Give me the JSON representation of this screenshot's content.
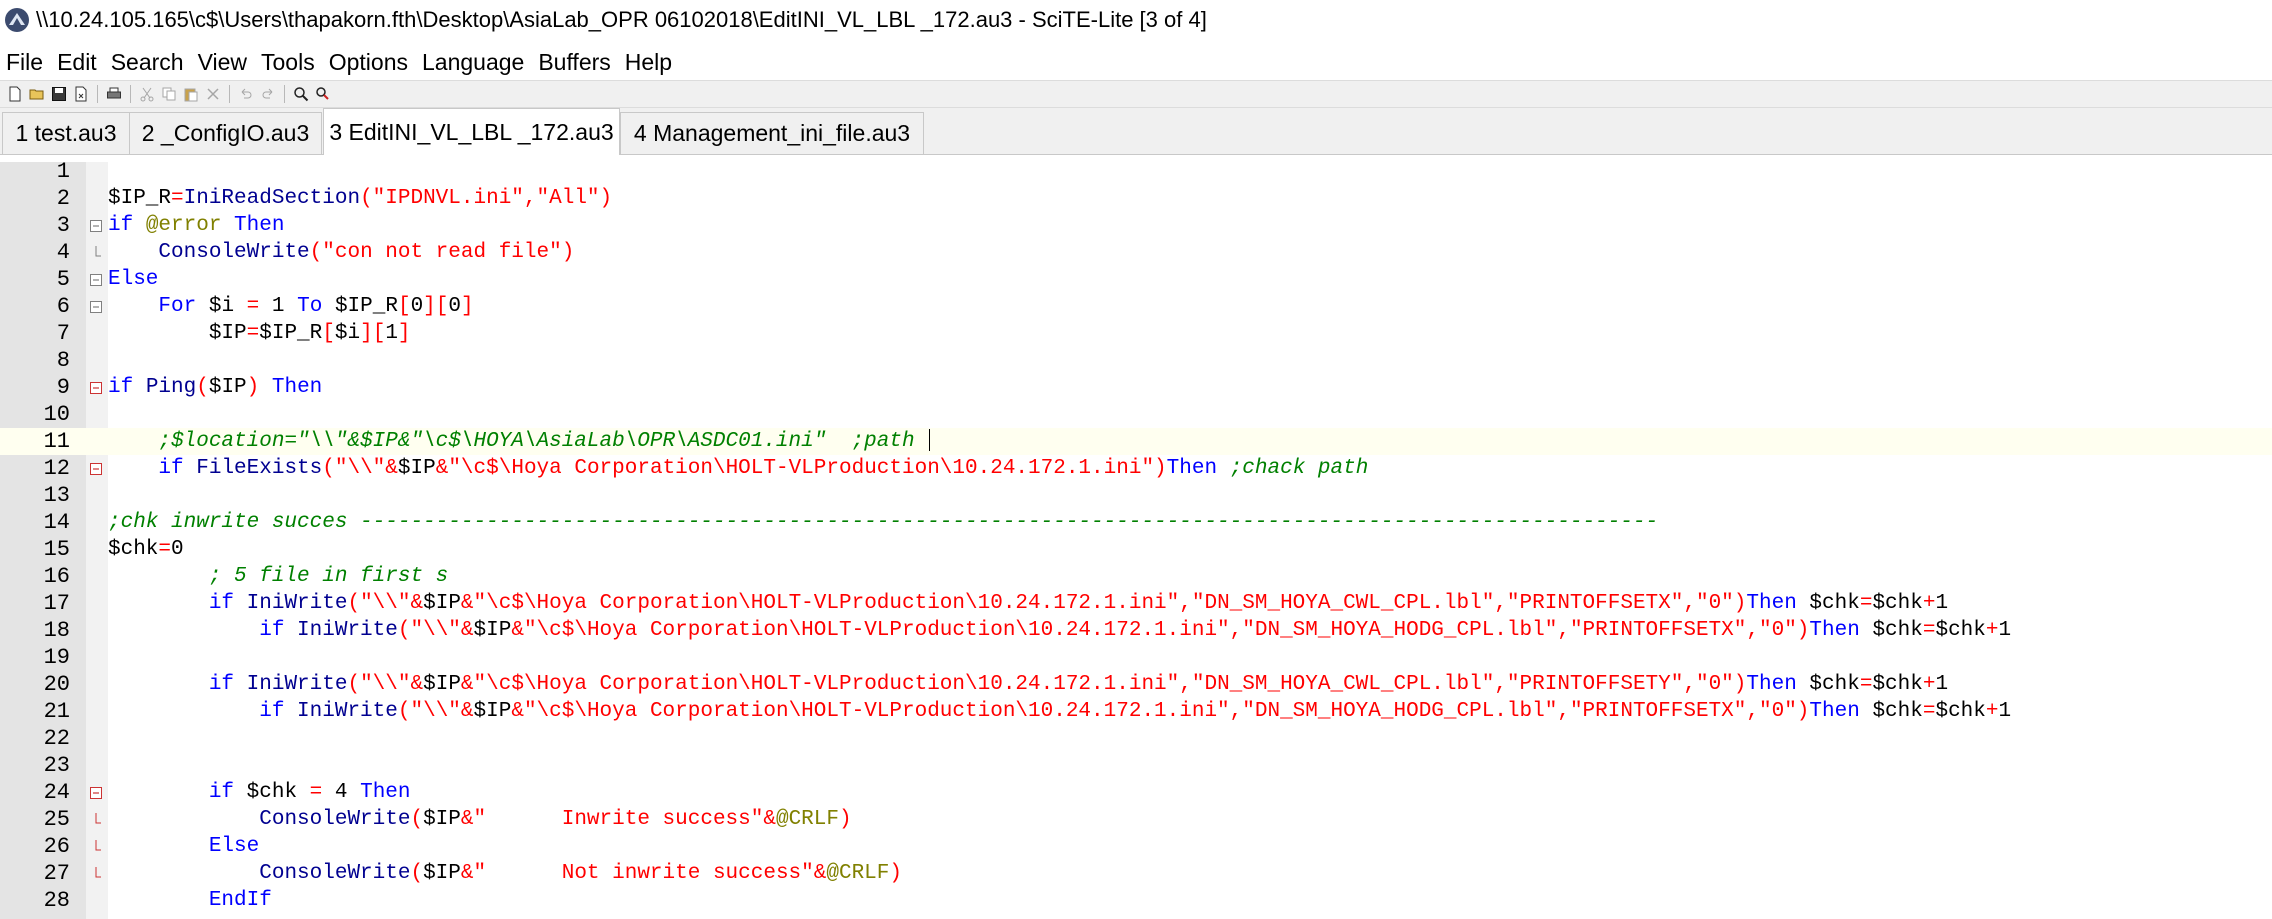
{
  "window": {
    "title": "\\\\10.24.105.165\\c$\\Users\\thapakorn.fth\\Desktop\\AsiaLab_OPR 06102018\\EditINI_VL_LBL _172.au3 - SciTE-Lite [3 of 4]",
    "app_icon": "scite-app-icon"
  },
  "menu": [
    "File",
    "Edit",
    "Search",
    "View",
    "Tools",
    "Options",
    "Language",
    "Buffers",
    "Help"
  ],
  "toolbar": [
    "new-file-icon",
    "open-folder-icon",
    "save-icon",
    "close-file-icon",
    "print-icon",
    "cut-icon",
    "copy-icon",
    "paste-icon",
    "delete-icon",
    "undo-icon",
    "redo-icon",
    "find-icon",
    "replace-icon"
  ],
  "tabs": [
    {
      "label": "1 test.au3",
      "active": false
    },
    {
      "label": "2 _ConfigIO.au3",
      "active": false
    },
    {
      "label": "3 EditINI_VL_LBL _172.au3",
      "active": true
    },
    {
      "label": "4 Management_ini_file.au3",
      "active": false
    }
  ],
  "colors": {
    "keyword": "#0000ff",
    "function": "#000090",
    "string": "#ff0000",
    "macro": "#808000",
    "comment": "#008000",
    "operator": "#ff0000",
    "number": "#000000",
    "variable": "#000000"
  },
  "editor": {
    "caret_line": 11,
    "lines": [
      [],
      [
        [
          "v",
          "$IP_R"
        ],
        [
          "o",
          "="
        ],
        [
          "f",
          "IniReadSection"
        ],
        [
          "o",
          "("
        ],
        [
          "s",
          "\"IPDNVL.ini\""
        ],
        [
          "o",
          ","
        ],
        [
          "s",
          "\"All\""
        ],
        [
          "o",
          ")"
        ]
      ],
      [
        [
          "k",
          "if "
        ],
        [
          "m",
          "@error"
        ],
        [
          "k",
          " Then"
        ]
      ],
      [
        [
          "t",
          "    "
        ],
        [
          "f",
          "ConsoleWrite"
        ],
        [
          "o",
          "("
        ],
        [
          "s",
          "\"con not read file\""
        ],
        [
          "o",
          ")"
        ]
      ],
      [
        [
          "k",
          "Else"
        ]
      ],
      [
        [
          "t",
          "    "
        ],
        [
          "k",
          "For"
        ],
        [
          "t",
          " "
        ],
        [
          "v",
          "$i"
        ],
        [
          "t",
          " "
        ],
        [
          "o",
          "="
        ],
        [
          "t",
          " "
        ],
        [
          "n",
          "1"
        ],
        [
          "t",
          " "
        ],
        [
          "k",
          "To"
        ],
        [
          "t",
          " "
        ],
        [
          "v",
          "$IP_R"
        ],
        [
          "o",
          "["
        ],
        [
          "n",
          "0"
        ],
        [
          "o",
          "]["
        ],
        [
          "n",
          "0"
        ],
        [
          "o",
          "]"
        ]
      ],
      [
        [
          "t",
          "        "
        ],
        [
          "v",
          "$IP"
        ],
        [
          "o",
          "="
        ],
        [
          "v",
          "$IP_R"
        ],
        [
          "o",
          "["
        ],
        [
          "v",
          "$i"
        ],
        [
          "o",
          "]["
        ],
        [
          "n",
          "1"
        ],
        [
          "o",
          "]"
        ]
      ],
      [],
      [
        [
          "k",
          "if "
        ],
        [
          "f",
          "Ping"
        ],
        [
          "o",
          "("
        ],
        [
          "v",
          "$IP"
        ],
        [
          "o",
          ")"
        ],
        [
          "k",
          " Then"
        ]
      ],
      [],
      [
        [
          "t",
          "    "
        ],
        [
          "c",
          ";$location=\"\\\\\"&$IP&\"\\c$\\HOYA\\AsiaLab\\OPR\\ASDC01.ini\"  ;path "
        ]
      ],
      [
        [
          "t",
          "    "
        ],
        [
          "k",
          "if "
        ],
        [
          "f",
          "FileExists"
        ],
        [
          "o",
          "("
        ],
        [
          "s",
          "\"\\\\\""
        ],
        [
          "o",
          "&"
        ],
        [
          "v",
          "$IP"
        ],
        [
          "o",
          "&"
        ],
        [
          "s",
          "\"\\c$\\Hoya Corporation\\HOLT-VLProduction\\10.24.172.1.ini\""
        ],
        [
          "o",
          ")"
        ],
        [
          "k",
          "Then"
        ],
        [
          "t",
          " "
        ],
        [
          "c",
          ";chack path"
        ]
      ],
      [],
      [
        [
          "c",
          ";chk inwrite succes -------------------------------------------------------------------------------------------------------"
        ]
      ],
      [
        [
          "v",
          "$chk"
        ],
        [
          "o",
          "="
        ],
        [
          "n",
          "0"
        ]
      ],
      [
        [
          "t",
          "        "
        ],
        [
          "c",
          "; 5 file in first s"
        ]
      ],
      [
        [
          "t",
          "        "
        ],
        [
          "k",
          "if "
        ],
        [
          "f",
          "IniWrite"
        ],
        [
          "o",
          "("
        ],
        [
          "s",
          "\"\\\\\""
        ],
        [
          "o",
          "&"
        ],
        [
          "v",
          "$IP"
        ],
        [
          "o",
          "&"
        ],
        [
          "s",
          "\"\\c$\\Hoya Corporation\\HOLT-VLProduction\\10.24.172.1.ini\""
        ],
        [
          "o",
          ","
        ],
        [
          "s",
          "\"DN_SM_HOYA_CWL_CPL.lbl\""
        ],
        [
          "o",
          ","
        ],
        [
          "s",
          "\"PRINTOFFSETX\""
        ],
        [
          "o",
          ","
        ],
        [
          "s",
          "\"0\""
        ],
        [
          "o",
          ")"
        ],
        [
          "k",
          "Then"
        ],
        [
          "t",
          " "
        ],
        [
          "v",
          "$chk"
        ],
        [
          "o",
          "="
        ],
        [
          "v",
          "$chk"
        ],
        [
          "o",
          "+"
        ],
        [
          "n",
          "1"
        ]
      ],
      [
        [
          "t",
          "            "
        ],
        [
          "k",
          "if "
        ],
        [
          "f",
          "IniWrite"
        ],
        [
          "o",
          "("
        ],
        [
          "s",
          "\"\\\\\""
        ],
        [
          "o",
          "&"
        ],
        [
          "v",
          "$IP"
        ],
        [
          "o",
          "&"
        ],
        [
          "s",
          "\"\\c$\\Hoya Corporation\\HOLT-VLProduction\\10.24.172.1.ini\""
        ],
        [
          "o",
          ","
        ],
        [
          "s",
          "\"DN_SM_HOYA_HODG_CPL.lbl\""
        ],
        [
          "o",
          ","
        ],
        [
          "s",
          "\"PRINTOFFSETX\""
        ],
        [
          "o",
          ","
        ],
        [
          "s",
          "\"0\""
        ],
        [
          "o",
          ")"
        ],
        [
          "k",
          "Then"
        ],
        [
          "t",
          " "
        ],
        [
          "v",
          "$chk"
        ],
        [
          "o",
          "="
        ],
        [
          "v",
          "$chk"
        ],
        [
          "o",
          "+"
        ],
        [
          "n",
          "1"
        ]
      ],
      [],
      [
        [
          "t",
          "        "
        ],
        [
          "k",
          "if "
        ],
        [
          "f",
          "IniWrite"
        ],
        [
          "o",
          "("
        ],
        [
          "s",
          "\"\\\\\""
        ],
        [
          "o",
          "&"
        ],
        [
          "v",
          "$IP"
        ],
        [
          "o",
          "&"
        ],
        [
          "s",
          "\"\\c$\\Hoya Corporation\\HOLT-VLProduction\\10.24.172.1.ini\""
        ],
        [
          "o",
          ","
        ],
        [
          "s",
          "\"DN_SM_HOYA_CWL_CPL.lbl\""
        ],
        [
          "o",
          ","
        ],
        [
          "s",
          "\"PRINTOFFSETY\""
        ],
        [
          "o",
          ","
        ],
        [
          "s",
          "\"0\""
        ],
        [
          "o",
          ")"
        ],
        [
          "k",
          "Then"
        ],
        [
          "t",
          " "
        ],
        [
          "v",
          "$chk"
        ],
        [
          "o",
          "="
        ],
        [
          "v",
          "$chk"
        ],
        [
          "o",
          "+"
        ],
        [
          "n",
          "1"
        ]
      ],
      [
        [
          "t",
          "            "
        ],
        [
          "k",
          "if "
        ],
        [
          "f",
          "IniWrite"
        ],
        [
          "o",
          "("
        ],
        [
          "s",
          "\"\\\\\""
        ],
        [
          "o",
          "&"
        ],
        [
          "v",
          "$IP"
        ],
        [
          "o",
          "&"
        ],
        [
          "s",
          "\"\\c$\\Hoya Corporation\\HOLT-VLProduction\\10.24.172.1.ini\""
        ],
        [
          "o",
          ","
        ],
        [
          "s",
          "\"DN_SM_HOYA_HODG_CPL.lbl\""
        ],
        [
          "o",
          ","
        ],
        [
          "s",
          "\"PRINTOFFSETX\""
        ],
        [
          "o",
          ","
        ],
        [
          "s",
          "\"0\""
        ],
        [
          "o",
          ")"
        ],
        [
          "k",
          "Then"
        ],
        [
          "t",
          " "
        ],
        [
          "v",
          "$chk"
        ],
        [
          "o",
          "="
        ],
        [
          "v",
          "$chk"
        ],
        [
          "o",
          "+"
        ],
        [
          "n",
          "1"
        ]
      ],
      [],
      [],
      [
        [
          "t",
          "        "
        ],
        [
          "k",
          "if "
        ],
        [
          "v",
          "$chk"
        ],
        [
          "t",
          " "
        ],
        [
          "o",
          "="
        ],
        [
          "t",
          " "
        ],
        [
          "n",
          "4"
        ],
        [
          "k",
          " Then"
        ]
      ],
      [
        [
          "t",
          "            "
        ],
        [
          "f",
          "ConsoleWrite"
        ],
        [
          "o",
          "("
        ],
        [
          "v",
          "$IP"
        ],
        [
          "o",
          "&"
        ],
        [
          "s",
          "\"      Inwrite success\""
        ],
        [
          "o",
          "&"
        ],
        [
          "m",
          "@CRLF"
        ],
        [
          "o",
          ")"
        ]
      ],
      [
        [
          "t",
          "        "
        ],
        [
          "k",
          "Else"
        ]
      ],
      [
        [
          "t",
          "            "
        ],
        [
          "f",
          "ConsoleWrite"
        ],
        [
          "o",
          "("
        ],
        [
          "v",
          "$IP"
        ],
        [
          "o",
          "&"
        ],
        [
          "s",
          "\"      Not inwrite success\""
        ],
        [
          "o",
          "&"
        ],
        [
          "m",
          "@CRLF"
        ],
        [
          "o",
          ")"
        ]
      ],
      [
        [
          "t",
          "        "
        ],
        [
          "k",
          "EndIf"
        ]
      ]
    ],
    "folds": [
      {
        "line": 3,
        "kind": "open"
      },
      {
        "line": 4,
        "kind": "end"
      },
      {
        "line": 5,
        "kind": "open"
      },
      {
        "line": 6,
        "kind": "open"
      },
      {
        "line": 9,
        "kind": "open-red"
      },
      {
        "line": 12,
        "kind": "open-red"
      },
      {
        "line": 24,
        "kind": "open-red"
      },
      {
        "line": 25,
        "kind": "end-red"
      },
      {
        "line": 26,
        "kind": "mid-red"
      },
      {
        "line": 27,
        "kind": "end-red"
      }
    ]
  }
}
